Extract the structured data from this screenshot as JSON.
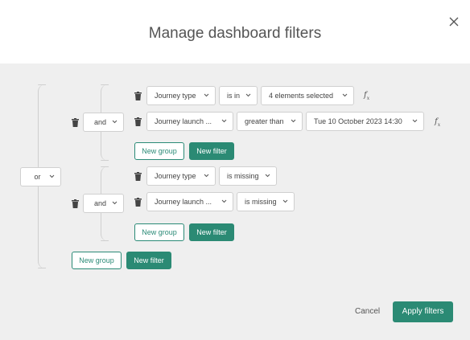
{
  "modal": {
    "title": "Manage dashboard filters"
  },
  "root": {
    "logic": "or",
    "groups": [
      {
        "logic": "and",
        "rows": [
          {
            "field": "Journey type",
            "operator": "is in",
            "value": "4 elements selected",
            "has_fx": true
          },
          {
            "field": "Journey launch ...",
            "operator": "greater than",
            "value": "Tue 10 October 2023 14:30",
            "has_fx": true
          }
        ],
        "new_group_label": "New group",
        "new_filter_label": "New filter"
      },
      {
        "logic": "and",
        "rows": [
          {
            "field": "Journey type",
            "operator": "is missing"
          },
          {
            "field": "Journey launch ...",
            "operator": "is missing"
          }
        ],
        "new_group_label": "New group",
        "new_filter_label": "New filter"
      }
    ],
    "new_group_label": "New group",
    "new_filter_label": "New filter"
  },
  "footer": {
    "cancel_label": "Cancel",
    "apply_label": "Apply filters"
  },
  "colors": {
    "accent": "#2b8a74",
    "background": "#efefef",
    "header": "#ffffff"
  },
  "icons": {
    "close": "close-icon",
    "delete": "trash-icon",
    "dropdown": "chevron-down-icon",
    "formula": "fx-icon"
  }
}
